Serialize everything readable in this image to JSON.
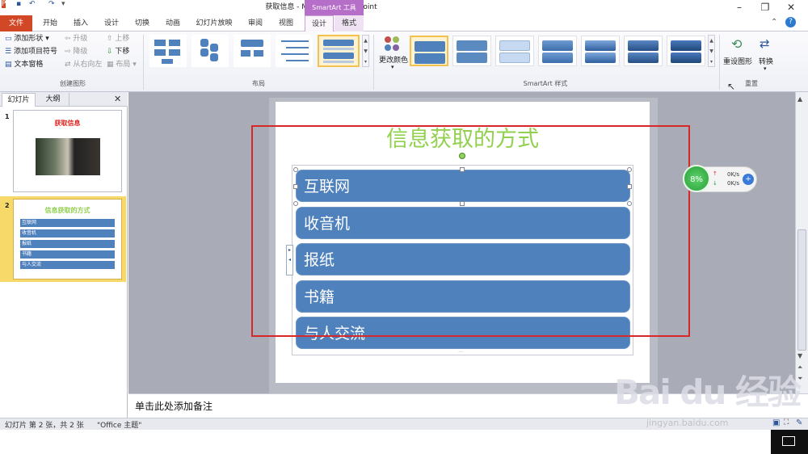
{
  "window": {
    "title": "获取信息 - Microsoft PowerPoint",
    "context_tab": "SmartArt 工具"
  },
  "tabs": [
    "文件",
    "开始",
    "插入",
    "设计",
    "切换",
    "动画",
    "幻灯片放映",
    "审阅",
    "视图",
    "设计",
    "格式"
  ],
  "ribbon": {
    "create_group": {
      "label": "创建图形",
      "add_shape": "添加形状",
      "add_bullet": "添加项目符号",
      "text_pane": "文本窗格",
      "promote": "升级",
      "demote": "降级",
      "right_to_left": "从右向左",
      "move_up": "上移",
      "move_down": "下移",
      "layout_btn": "布局"
    },
    "layout_group": {
      "label": "布局"
    },
    "styles_group": {
      "label": "SmartArt 样式",
      "change_colors": "更改颜色"
    },
    "reset_group": {
      "label": "重置",
      "reset_graphic": "重设图形",
      "convert": "转换"
    }
  },
  "left_pane": {
    "tabs": [
      "幻灯片",
      "大纲"
    ],
    "close": "✕",
    "slides": [
      {
        "number": "1",
        "title": "获取信息"
      },
      {
        "number": "2",
        "title": "信息获取的方式",
        "items": [
          "互联网",
          "收音机",
          "报纸",
          "书籍",
          "与人交流"
        ]
      }
    ]
  },
  "slide": {
    "title": "信息获取的方式",
    "items": [
      "互联网",
      "收音机",
      "报纸",
      "书籍",
      "与人交流"
    ]
  },
  "notes": {
    "placeholder": "单击此处添加备注"
  },
  "status": {
    "slide_info": "幻灯片 第 2 张，共 2 张",
    "theme": "\"Office 主题\""
  },
  "widget": {
    "percent": "8%",
    "up_speed": "0K/s",
    "down_speed": "0K/s"
  },
  "watermark": {
    "logo": "Bai du 经验",
    "url": "jingyan.baidu.com"
  },
  "colors": {
    "accent": "#4f81bd",
    "title_green": "#92d050",
    "highlight": "#d62828",
    "file_tab": "#d24726",
    "context": "#b66fc9"
  }
}
